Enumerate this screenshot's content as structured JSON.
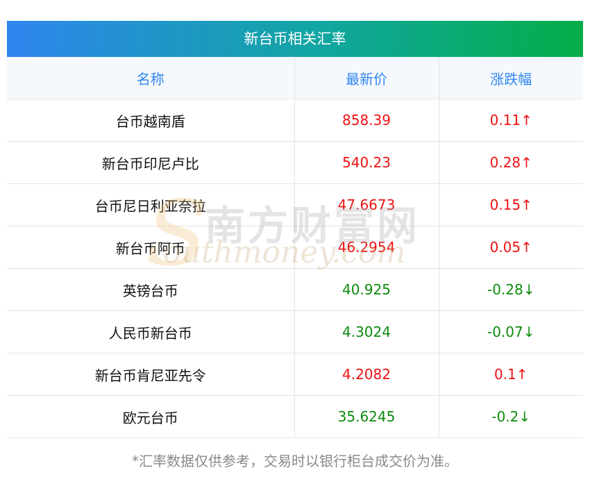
{
  "title": "新台币相关汇率",
  "columns": {
    "name": "名称",
    "price": "最新价",
    "change": "涨跌幅"
  },
  "rows": [
    {
      "name": "台币越南盾",
      "price": "858.39",
      "change": "0.11↑",
      "direction": "up"
    },
    {
      "name": "新台币印尼卢比",
      "price": "540.23",
      "change": "0.28↑",
      "direction": "up"
    },
    {
      "name": "台币尼日利亚奈拉",
      "price": "47.6673",
      "change": "0.15↑",
      "direction": "up"
    },
    {
      "name": "新台币阿币",
      "price": "46.2954",
      "change": "0.05↑",
      "direction": "up"
    },
    {
      "name": "英镑台币",
      "price": "40.925",
      "change": "-0.28↓",
      "direction": "down"
    },
    {
      "name": "人民币新台币",
      "price": "4.3024",
      "change": "-0.07↓",
      "direction": "down"
    },
    {
      "name": "新台币肯尼亚先令",
      "price": "4.2082",
      "change": "0.1↑",
      "direction": "up"
    },
    {
      "name": "欧元台币",
      "price": "35.6245",
      "change": "-0.2↓",
      "direction": "down"
    }
  ],
  "watermark": {
    "cn": "南方财富网",
    "s": "S",
    "en": "outhmoney.com"
  },
  "footnote": "*汇率数据仅供参考，交易时以银行柜台成交价为准。",
  "colors": {
    "header_start": "#2f86ef",
    "header_end": "#05ad47",
    "up": "#ee1111",
    "down": "#0d8a0d",
    "column_header_text": "#2f86ef"
  }
}
